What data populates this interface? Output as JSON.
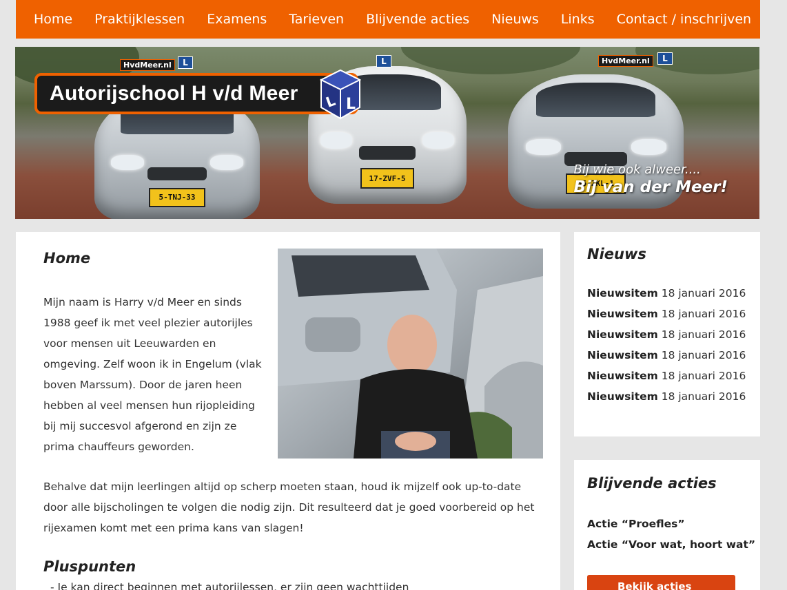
{
  "nav": {
    "items": [
      "Home",
      "Praktijklessen",
      "Examens",
      "Tarieven",
      "Blijvende acties",
      "Nieuws",
      "Links",
      "Contact / inschrijven"
    ]
  },
  "hero": {
    "logo_text": "Autorijschool H v/d Meer",
    "slogan_line1": "Bij wie ook alweer....",
    "slogan_line2": "Bij van der Meer!",
    "plates": [
      "5-TNJ-33",
      "17-ZVF-5",
      "36-ZKL-1"
    ],
    "roof_signs": [
      "HvdMeer.nl",
      "HvdMeer.nl"
    ],
    "l_sign": "L"
  },
  "main": {
    "title": "Home",
    "intro": "Mijn naam is Harry v/d Meer en sinds 1988 geef ik met veel plezier autorijles voor mensen uit Leeuwarden en omgeving. Zelf woon ik in Engelum (vlak boven Marssum). Door de jaren heen hebben al veel mensen hun rijopleiding bij mij succesvol afgerond en zijn ze prima chauffeurs geworden.",
    "paragraph2": "Behalve dat mijn leerlingen altijd op scherp moeten staan, houd ik mijzelf ook up-to-date door alle bijscholingen te volgen die nodig zijn. Dit resulteerd dat je goed voorbereid op het rijexamen komt met een prima kans van slagen!",
    "plus_title": "Pluspunten",
    "plus_item_1": "- Je kan direct beginnen met autorijlessen, er zijn geen wachttijden"
  },
  "sidebar": {
    "news_title": "Nieuws",
    "news": [
      {
        "label": "Nieuwsitem",
        "date": "18 januari 2016"
      },
      {
        "label": "Nieuwsitem",
        "date": "18 januari 2016"
      },
      {
        "label": "Nieuwsitem",
        "date": "18 januari 2016"
      },
      {
        "label": "Nieuwsitem",
        "date": "18 januari 2016"
      },
      {
        "label": "Nieuwsitem",
        "date": "18 januari 2016"
      },
      {
        "label": "Nieuwsitem",
        "date": "18 januari 2016"
      }
    ],
    "acts_title": "Blijvende acties",
    "acts": [
      "Actie “Proefles”",
      "Actie “Voor wat, hoort wat”"
    ],
    "acts_button": "Bekijk acties"
  },
  "colors": {
    "accent": "#ef6100",
    "button": "#d94411",
    "background": "#e6e6e6"
  }
}
